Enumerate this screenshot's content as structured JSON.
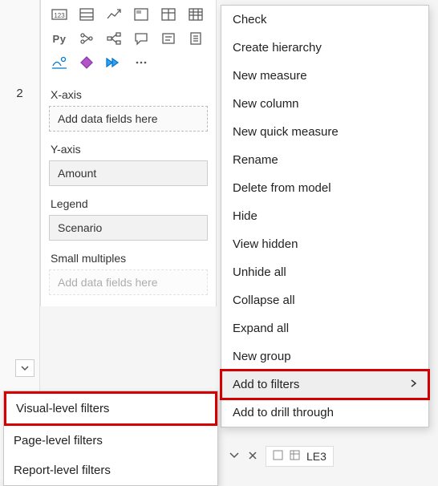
{
  "left": {
    "page_number": "2"
  },
  "panel": {
    "xaxis": {
      "label": "X-axis",
      "placeholder": "Add data fields here"
    },
    "yaxis": {
      "label": "Y-axis",
      "value": "Amount"
    },
    "legend": {
      "label": "Legend",
      "value": "Scenario"
    },
    "small_multiples": {
      "label": "Small multiples",
      "placeholder": "Add data fields here"
    }
  },
  "context_menu": {
    "items": [
      "Check",
      "Create hierarchy",
      "New measure",
      "New column",
      "New quick measure",
      "Rename",
      "Delete from model",
      "Hide",
      "View hidden",
      "Unhide all",
      "Collapse all",
      "Expand all",
      "New group",
      "Add to filters",
      "Add to drill through"
    ]
  },
  "filters_flyout": {
    "items": [
      "Visual-level filters",
      "Page-level filters",
      "Report-level filters"
    ]
  },
  "bottom": {
    "field_label": "LE3"
  }
}
